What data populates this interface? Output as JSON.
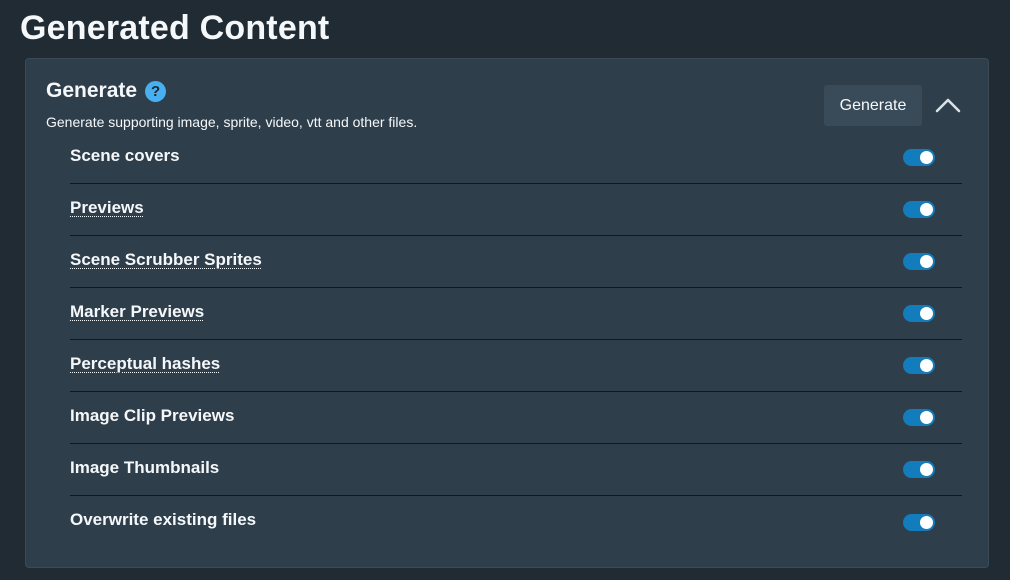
{
  "page": {
    "title": "Generated Content"
  },
  "card": {
    "title": "Generate",
    "help_glyph": "?",
    "description": "Generate supporting image, sprite, video, vtt and other files.",
    "generate_button": "Generate",
    "collapse_icon": "chevron-up-icon"
  },
  "options": [
    {
      "label": "Scene covers",
      "dotted": false,
      "checked": true
    },
    {
      "label": "Previews",
      "dotted": true,
      "checked": true
    },
    {
      "label": "Scene Scrubber Sprites",
      "dotted": true,
      "checked": true
    },
    {
      "label": "Marker Previews",
      "dotted": true,
      "checked": true
    },
    {
      "label": "Perceptual hashes",
      "dotted": true,
      "checked": true
    },
    {
      "label": "Image Clip Previews",
      "dotted": false,
      "checked": true
    },
    {
      "label": "Image Thumbnails",
      "dotted": false,
      "checked": true
    },
    {
      "label": "Overwrite existing files",
      "dotted": false,
      "checked": true
    }
  ],
  "colors": {
    "toggle_on": "#137cbd",
    "help_icon": "#48aff0",
    "card_bg": "#2f3e4b",
    "page_bg": "#202b33"
  }
}
